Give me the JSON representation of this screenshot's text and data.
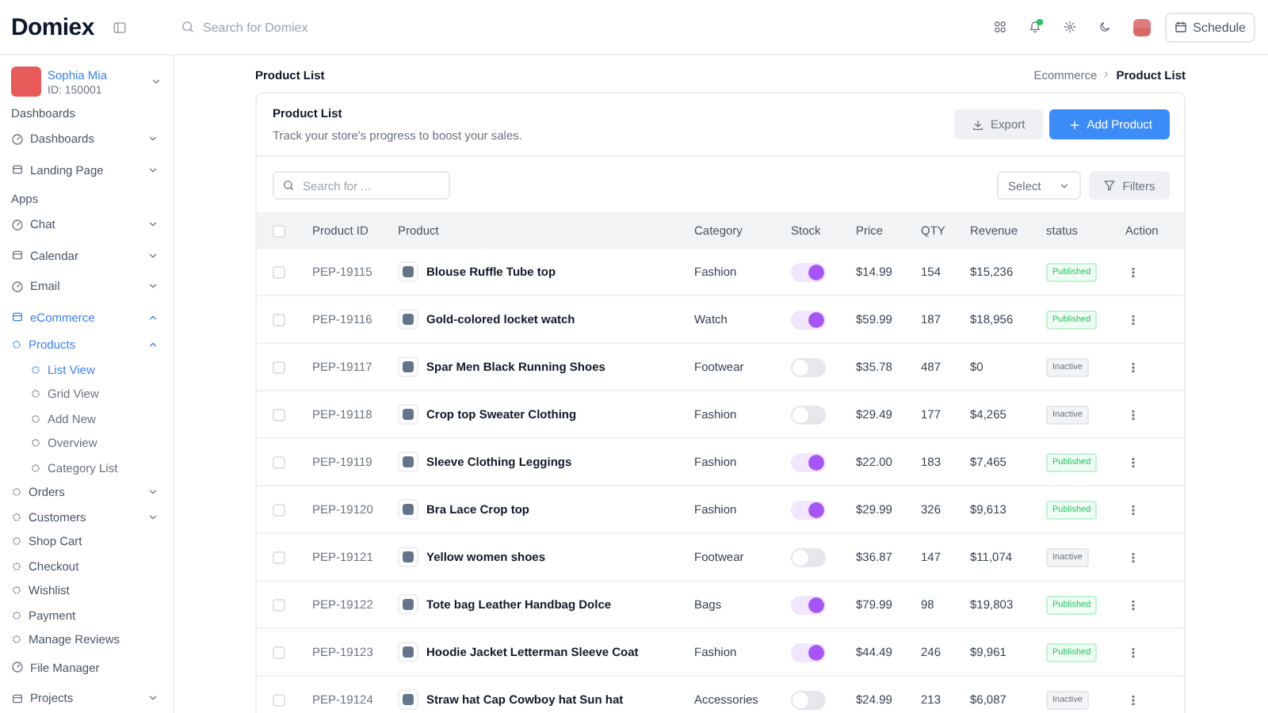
{
  "header": {
    "logo": "Domiex",
    "search": {
      "placeholder": "Search for Domiex"
    },
    "schedule_button": "Schedule"
  },
  "user": {
    "name": "Sophia Mia",
    "id": "ID: 150001"
  },
  "sidebar": {
    "groups": [
      {
        "heading": "Dashboards",
        "items": [
          {
            "label": "Dashboards",
            "kind": "collapsible",
            "expanded": false,
            "selected": false
          },
          {
            "label": "Landing Page",
            "kind": "collapsible",
            "expanded": false,
            "selected": false
          }
        ]
      },
      {
        "heading": "Apps",
        "items": [
          {
            "label": "Chat",
            "kind": "collapsible",
            "expanded": false,
            "selected": false
          },
          {
            "label": "Calendar",
            "kind": "collapsible",
            "expanded": false,
            "selected": false
          },
          {
            "label": "Email",
            "kind": "collapsible",
            "expanded": false,
            "selected": false
          },
          {
            "label": "eCommerce",
            "kind": "collapsible",
            "expanded": true,
            "selected": true,
            "children": [
              {
                "label": "Products",
                "kind": "collapsible",
                "expanded": true,
                "selected": true,
                "children": [
                  {
                    "label": "List View",
                    "kind": "link",
                    "selected": true
                  },
                  {
                    "label": "Grid View",
                    "kind": "link",
                    "selected": false
                  },
                  {
                    "label": "Add New",
                    "kind": "link",
                    "selected": false
                  },
                  {
                    "label": "Overview",
                    "kind": "link",
                    "selected": false
                  },
                  {
                    "label": "Category List",
                    "kind": "link",
                    "selected": false
                  }
                ]
              },
              {
                "label": "Orders",
                "kind": "collapsible",
                "expanded": false,
                "selected": false
              },
              {
                "label": "Customers",
                "kind": "collapsible",
                "expanded": false,
                "selected": false
              },
              {
                "label": "Shop Cart",
                "kind": "link",
                "selected": false
              },
              {
                "label": "Checkout",
                "kind": "link",
                "selected": false
              },
              {
                "label": "Wishlist",
                "kind": "link",
                "selected": false
              },
              {
                "label": "Payment",
                "kind": "link",
                "selected": false
              },
              {
                "label": "Manage Reviews",
                "kind": "link",
                "selected": false
              }
            ]
          },
          {
            "label": "File Manager",
            "kind": "link",
            "selected": false
          },
          {
            "label": "Projects",
            "kind": "collapsible",
            "expanded": false,
            "selected": false
          }
        ]
      }
    ]
  },
  "page": {
    "title": "Product List",
    "breadcrumb": [
      "Ecommerce",
      "Product List"
    ]
  },
  "card": {
    "title": "Product List",
    "subtitle": "Track your store's progress to boost your sales.",
    "export_button": "Export",
    "add_button": "Add Product",
    "search": {
      "placeholder": "Search for ..."
    },
    "select": "Select",
    "filters_button": "Filters"
  },
  "table": {
    "all_selected": false,
    "columns": [
      "Product ID",
      "Product",
      "Category",
      "Stock",
      "Price",
      "QTY",
      "Revenue",
      "status",
      "Action"
    ],
    "rows": [
      {
        "selected": false,
        "id": "PEP-19115",
        "product": "Blouse Ruffle Tube top",
        "category": "Fashion",
        "in_stock": true,
        "price": "$14.99",
        "qty": "154",
        "revenue": "$15,236",
        "status": {
          "label": "Published",
          "kind": "published"
        }
      },
      {
        "selected": false,
        "id": "PEP-19116",
        "product": "Gold-colored locket watch",
        "category": "Watch",
        "in_stock": true,
        "price": "$59.99",
        "qty": "187",
        "revenue": "$18,956",
        "status": {
          "label": "Published",
          "kind": "published"
        }
      },
      {
        "selected": false,
        "id": "PEP-19117",
        "product": "Spar Men Black Running Shoes",
        "category": "Footwear",
        "in_stock": false,
        "price": "$35.78",
        "qty": "487",
        "revenue": "$0",
        "status": {
          "label": "Inactive",
          "kind": "inactive"
        }
      },
      {
        "selected": false,
        "id": "PEP-19118",
        "product": "Crop top Sweater Clothing",
        "category": "Fashion",
        "in_stock": false,
        "price": "$29.49",
        "qty": "177",
        "revenue": "$4,265",
        "status": {
          "label": "Inactive",
          "kind": "inactive"
        }
      },
      {
        "selected": false,
        "id": "PEP-19119",
        "product": "Sleeve Clothing Leggings",
        "category": "Fashion",
        "in_stock": true,
        "price": "$22.00",
        "qty": "183",
        "revenue": "$7,465",
        "status": {
          "label": "Published",
          "kind": "published"
        }
      },
      {
        "selected": false,
        "id": "PEP-19120",
        "product": "Bra Lace Crop top",
        "category": "Fashion",
        "in_stock": true,
        "price": "$29.99",
        "qty": "326",
        "revenue": "$9,613",
        "status": {
          "label": "Published",
          "kind": "published"
        }
      },
      {
        "selected": false,
        "id": "PEP-19121",
        "product": "Yellow women shoes",
        "category": "Footwear",
        "in_stock": false,
        "price": "$36.87",
        "qty": "147",
        "revenue": "$11,074",
        "status": {
          "label": "Inactive",
          "kind": "inactive"
        }
      },
      {
        "selected": false,
        "id": "PEP-19122",
        "product": "Tote bag Leather Handbag Dolce",
        "category": "Bags",
        "in_stock": true,
        "price": "$79.99",
        "qty": "98",
        "revenue": "$19,803",
        "status": {
          "label": "Published",
          "kind": "published"
        }
      },
      {
        "selected": false,
        "id": "PEP-19123",
        "product": "Hoodie Jacket Letterman Sleeve Coat",
        "category": "Fashion",
        "in_stock": true,
        "price": "$44.49",
        "qty": "246",
        "revenue": "$9,961",
        "status": {
          "label": "Published",
          "kind": "published"
        }
      },
      {
        "selected": false,
        "id": "PEP-19124",
        "product": "Straw hat Cap Cowboy hat Sun hat",
        "category": "Accessories",
        "in_stock": false,
        "price": "$24.99",
        "qty": "213",
        "revenue": "$6,087",
        "status": {
          "label": "Inactive",
          "kind": "inactive"
        }
      }
    ]
  }
}
